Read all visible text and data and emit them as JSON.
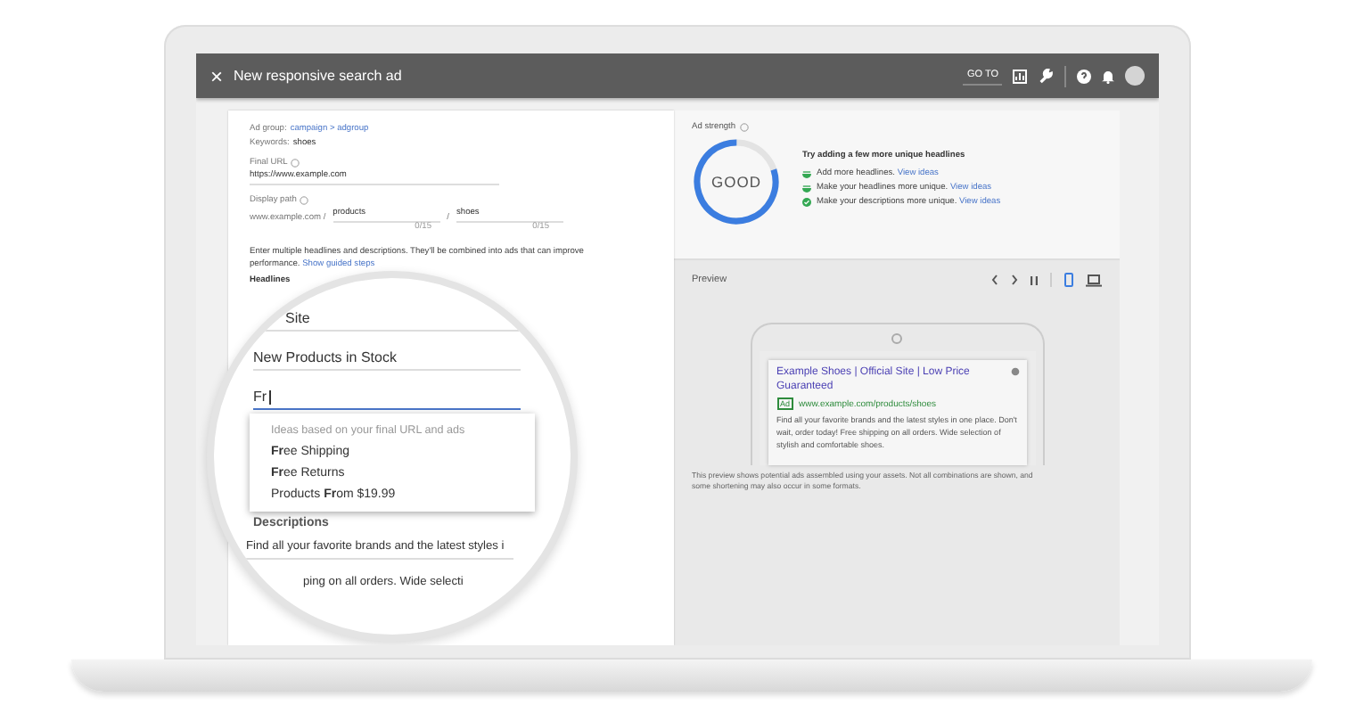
{
  "top_bar": {
    "close_icon": "×",
    "title": "New responsive search ad",
    "goto_button": "GO TO"
  },
  "form": {
    "ad_group_label": "Ad group:",
    "ad_group_value": "campaign > adgroup",
    "keywords_label": "Keywords:",
    "keywords_value": "shoes",
    "final_url_label": "Final URL",
    "final_url_value": "https://www.example.com",
    "display_path_label": "Display path",
    "display_path_base": "www.example.com /",
    "path_1": "products",
    "path_separator": "/",
    "path_2": "shoes",
    "path_1_count": "0/15",
    "path_2_count": "0/15",
    "instructions": "Enter multiple headlines and descriptions. They'll be combined into ads that can improve performance.",
    "guided_link": "Show guided steps",
    "headlines_label": "Headlines"
  },
  "magnifier": {
    "headline_1": "Site",
    "headline_2": "New Products in Stock",
    "headline_3": "Fr",
    "suggestions_title": "Ideas based on your final URL and ads",
    "suggestions": [
      {
        "text": "**Fr**ee Shipping"
      },
      {
        "text": "**Fr**ee Returns"
      },
      {
        "text": "Products **Fr**om $19.99"
      }
    ],
    "descriptions_label": "Descriptions",
    "description_1": "Find all your favorite brands and the latest styles i",
    "description_2": "ping on all orders. Wide selecti"
  },
  "ad_strength": {
    "title": "Ad strength",
    "rating": "GOOD",
    "level": 0.8,
    "heading": "Try adding a few more unique headlines",
    "tips": [
      {
        "text": "Add more headlines.",
        "link": "View ideas",
        "done": false
      },
      {
        "text": "Make your headlines more unique.",
        "link": "View ideas",
        "done": false
      },
      {
        "text": "Make your descriptions more unique.",
        "link": "View ideas",
        "done": true
      }
    ]
  },
  "preview": {
    "title": "Preview",
    "devices": [
      {
        "kind": "mobile",
        "selected": true
      },
      {
        "kind": "desktop",
        "selected": false
      }
    ],
    "ad_title": "Example Shoes | Official Site | Low Price Guaranteed",
    "ad_badge": "Ad",
    "ad_url": "www.example.com/products/shoes",
    "ad_description": "Find all your favorite brands and the latest styles in one place. Don't wait, order today! Free shipping on all orders. Wide selection of stylish and comfortable shoes.",
    "note": "This preview shows potential ads assembled using your assets. Not all combinations are shown, and some shortening may also occur in some formats."
  }
}
